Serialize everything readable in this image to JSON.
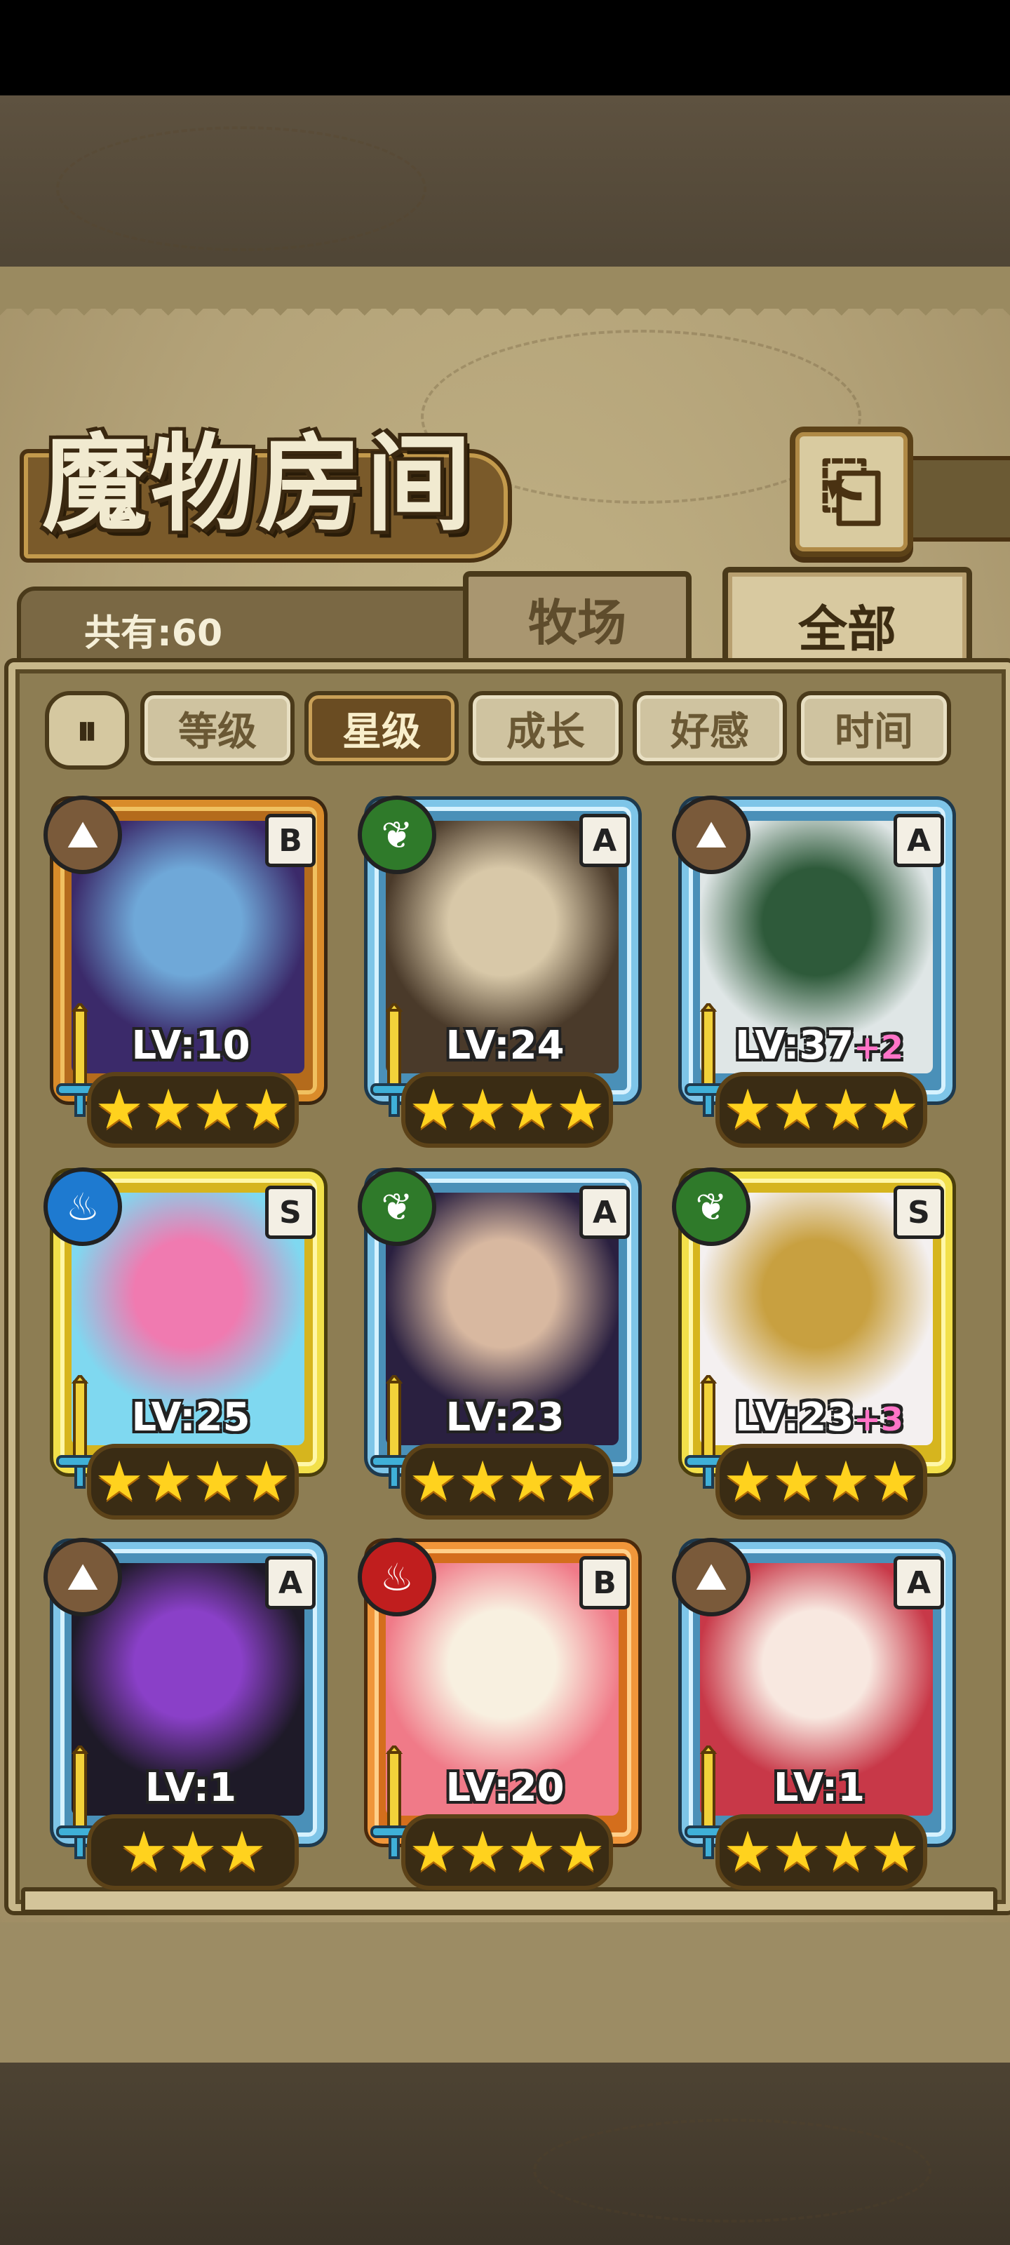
{
  "header": {
    "title": "魔物房间",
    "back_icon": "back-arrow-icon"
  },
  "tabs": {
    "count_text": "共有:60",
    "farm_label": "牧场",
    "all_label": "全部",
    "selected": "全部"
  },
  "sort": {
    "toggle_icon": "pause-sort-icon",
    "options": [
      "等级",
      "星级",
      "成长",
      "好感",
      "时间"
    ],
    "selected": "星级"
  },
  "monsters": [
    {
      "level": "LV:10",
      "plus": "",
      "rank": "B",
      "element": "earth",
      "stars": "★★★★",
      "frame": "bronze",
      "art": [
        "#3b2a6a",
        "#6fa8d8"
      ]
    },
    {
      "level": "LV:24",
      "plus": "",
      "rank": "A",
      "element": "leaf",
      "stars": "★★★★",
      "frame": "blue",
      "art": [
        "#4a3a2a",
        "#d8c8a8"
      ]
    },
    {
      "level": "LV:37",
      "plus": "+2",
      "rank": "A",
      "element": "earth",
      "stars": "★★★★",
      "frame": "blue",
      "art": [
        "#dfe6e6",
        "#2e5a3a"
      ]
    },
    {
      "level": "LV:25",
      "plus": "",
      "rank": "S",
      "element": "water",
      "stars": "★★★★",
      "frame": "gold",
      "art": [
        "#7fd8f0",
        "#f07ab0"
      ]
    },
    {
      "level": "LV:23",
      "plus": "",
      "rank": "A",
      "element": "leaf",
      "stars": "★★★★",
      "frame": "blue",
      "art": [
        "#2a2040",
        "#d8b8a0"
      ]
    },
    {
      "level": "LV:23",
      "plus": "+3",
      "rank": "S",
      "element": "leaf",
      "stars": "★★★★",
      "frame": "gold",
      "art": [
        "#f4f0f0",
        "#c8a040"
      ]
    },
    {
      "level": "LV:1",
      "plus": "",
      "rank": "A",
      "element": "earth",
      "stars": "★★★",
      "frame": "blue",
      "art": [
        "#1e1a28",
        "#8a40c8"
      ]
    },
    {
      "level": "LV:20",
      "plus": "",
      "rank": "B",
      "element": "fire",
      "stars": "★★★★",
      "frame": "orange",
      "art": [
        "#f07a88",
        "#f8f0e0"
      ]
    },
    {
      "level": "LV:1",
      "plus": "",
      "rank": "A",
      "element": "earth",
      "stars": "★★★★",
      "frame": "blue",
      "art": [
        "#c83848",
        "#f8e8e0"
      ]
    }
  ],
  "element_colors": {
    "earth": "#7a5a3a",
    "leaf": "#2f7a2a",
    "water": "#1e7ad0",
    "fire": "#c01e1e"
  }
}
